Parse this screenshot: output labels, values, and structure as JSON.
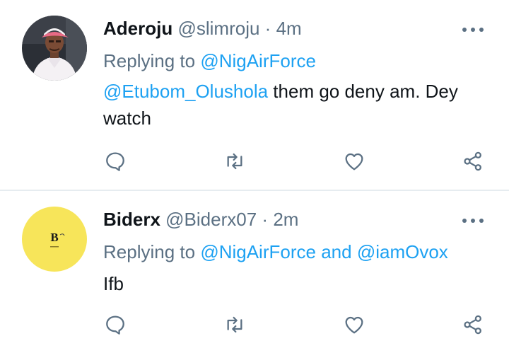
{
  "tweets": [
    {
      "name": "Aderoju",
      "handle": "@slimroju",
      "separator": "·",
      "time": "4m",
      "replying_prefix": "Replying to",
      "replying_to_1": "@NigAirForce",
      "replying_and": "",
      "replying_to_2": "",
      "mention": "@Etubom_Olushola",
      "text": " them go deny am. Dey watch"
    },
    {
      "name": "Biderx",
      "handle": "@Biderx07",
      "separator": "·",
      "time": "2m",
      "replying_prefix": "Replying to",
      "replying_to_1": "@NigAirForce",
      "replying_and": "and",
      "replying_to_2": "@iamOvox",
      "mention": "",
      "text": "Ifb"
    }
  ],
  "avatar_logo_letter": "B",
  "colors": {
    "link": "#1da1f2",
    "muted": "#5b7083",
    "text": "#0f1419",
    "divider": "#e6ecf0",
    "avatar2_bg": "#f7e55a"
  },
  "icons": [
    "more-icon",
    "reply-icon",
    "retweet-icon",
    "like-icon",
    "share-icon"
  ]
}
